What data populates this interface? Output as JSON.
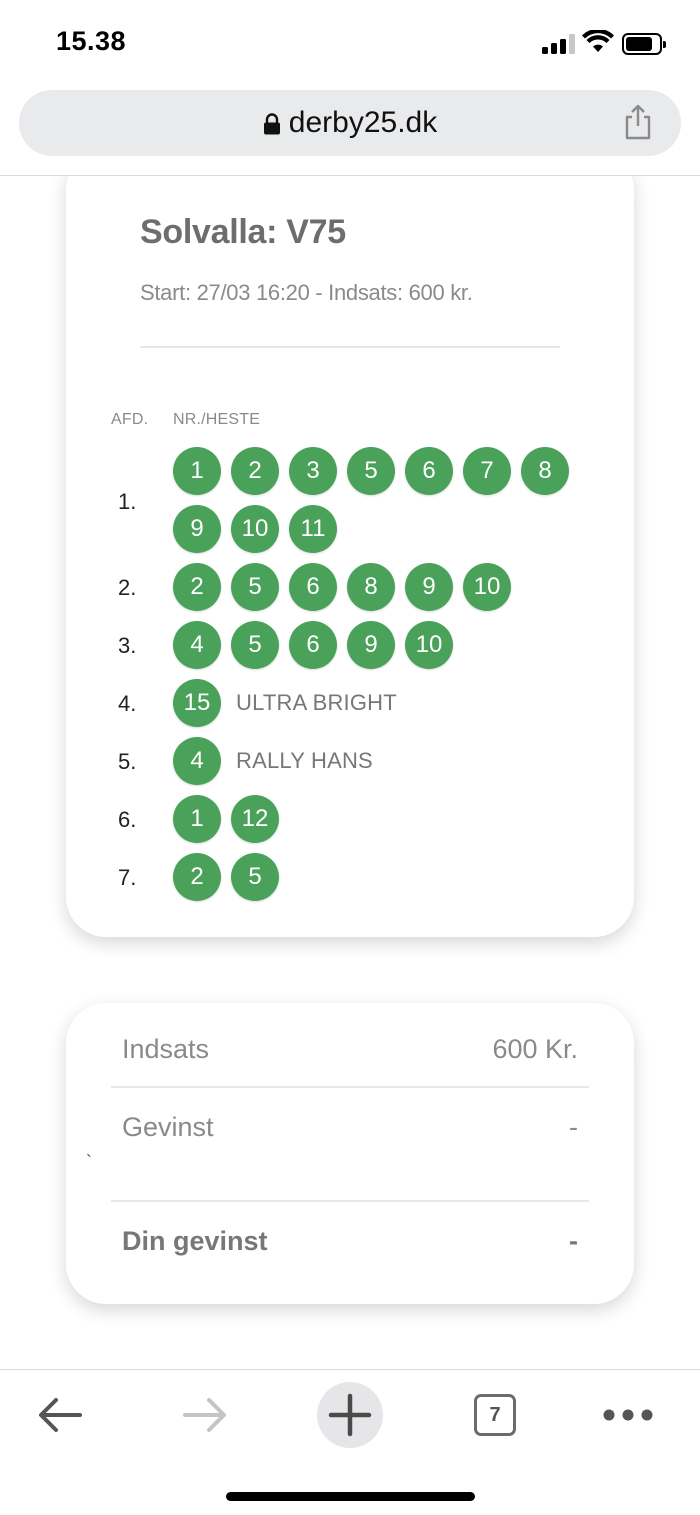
{
  "status_bar": {
    "time": "15.38"
  },
  "browser": {
    "url": "derby25.dk",
    "tab_count": "7"
  },
  "race": {
    "title": "Solvalla: V75",
    "subtitle": "Start: 27/03 16:20 - Indsats: 600 kr.",
    "col_leg": "AFD.",
    "col_horses": "NR./HESTE",
    "legs": [
      {
        "label": "1.",
        "horses": [
          "1",
          "2",
          "3",
          "5",
          "6",
          "7",
          "8",
          "9",
          "10",
          "11"
        ],
        "name": ""
      },
      {
        "label": "2.",
        "horses": [
          "2",
          "5",
          "6",
          "8",
          "9",
          "10"
        ],
        "name": ""
      },
      {
        "label": "3.",
        "horses": [
          "4",
          "5",
          "6",
          "9",
          "10"
        ],
        "name": ""
      },
      {
        "label": "4.",
        "horses": [
          "15"
        ],
        "name": "ULTRA BRIGHT"
      },
      {
        "label": "5.",
        "horses": [
          "4"
        ],
        "name": "RALLY HANS"
      },
      {
        "label": "6.",
        "horses": [
          "1",
          "12"
        ],
        "name": ""
      },
      {
        "label": "7.",
        "horses": [
          "2",
          "5"
        ],
        "name": ""
      }
    ]
  },
  "summary": {
    "stake_label": "Indsats",
    "stake_value": "600 Kr.",
    "win_label": "Gevinst",
    "win_value": "-",
    "stray_mark": "`",
    "your_win_label": "Din gevinst",
    "your_win_value": "-"
  },
  "colors": {
    "ball": "#4aa15a",
    "text_muted": "#8a8a8a"
  }
}
